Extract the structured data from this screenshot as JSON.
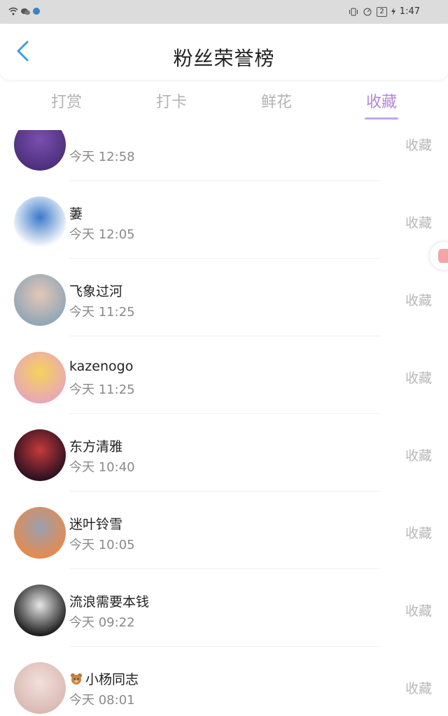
{
  "status_bar": {
    "battery": "2",
    "time": "1:47"
  },
  "header": {
    "title": "粉丝荣誉榜"
  },
  "tabs": [
    {
      "label": "打赏"
    },
    {
      "label": "打卡"
    },
    {
      "label": "鲜花"
    },
    {
      "label": "收藏"
    }
  ],
  "active_tab": "收藏",
  "list": [
    {
      "name": "",
      "time": "今天 12:58",
      "action": "收藏",
      "avatar_colors": [
        "#4c2f7a",
        "#7a4fb0"
      ]
    },
    {
      "name": "萋",
      "time": "今天 12:05",
      "action": "收藏",
      "avatar_colors": [
        "#ffffff",
        "#3a79c9"
      ]
    },
    {
      "name": "飞象过河",
      "time": "今天 11:25",
      "action": "收藏",
      "avatar_colors": [
        "#8fa6b5",
        "#e4c7b8"
      ]
    },
    {
      "name": "kazenogo",
      "time": "今天 11:25",
      "action": "收藏",
      "avatar_colors": [
        "#e8a6b8",
        "#f5d35a"
      ]
    },
    {
      "name": "东方清雅",
      "time": "今天 10:40",
      "action": "收藏",
      "avatar_colors": [
        "#2a1020",
        "#c63a3a"
      ]
    },
    {
      "name": "迷叶铃雪",
      "time": "今天 10:05",
      "action": "收藏",
      "avatar_colors": [
        "#e58a4f",
        "#9aa0b0"
      ]
    },
    {
      "name": "流浪需要本钱",
      "time": "今天 09:22",
      "action": "收藏",
      "avatar_colors": [
        "#1a1a1a",
        "#e7e7e7"
      ]
    },
    {
      "name": "小杨同志",
      "time": "今天 08:01",
      "action": "收藏",
      "avatar_colors": [
        "#d9b9b2",
        "#f3e0dc"
      ]
    }
  ],
  "colors": {
    "accent": "#b287dc",
    "inactive_tab": "#b3b3b3",
    "status_bar_bg": "#dcdcdc"
  },
  "icons": {
    "back": "chevron-left-icon",
    "wifi": "wifi-icon",
    "bear": "bear-emoji-icon"
  }
}
